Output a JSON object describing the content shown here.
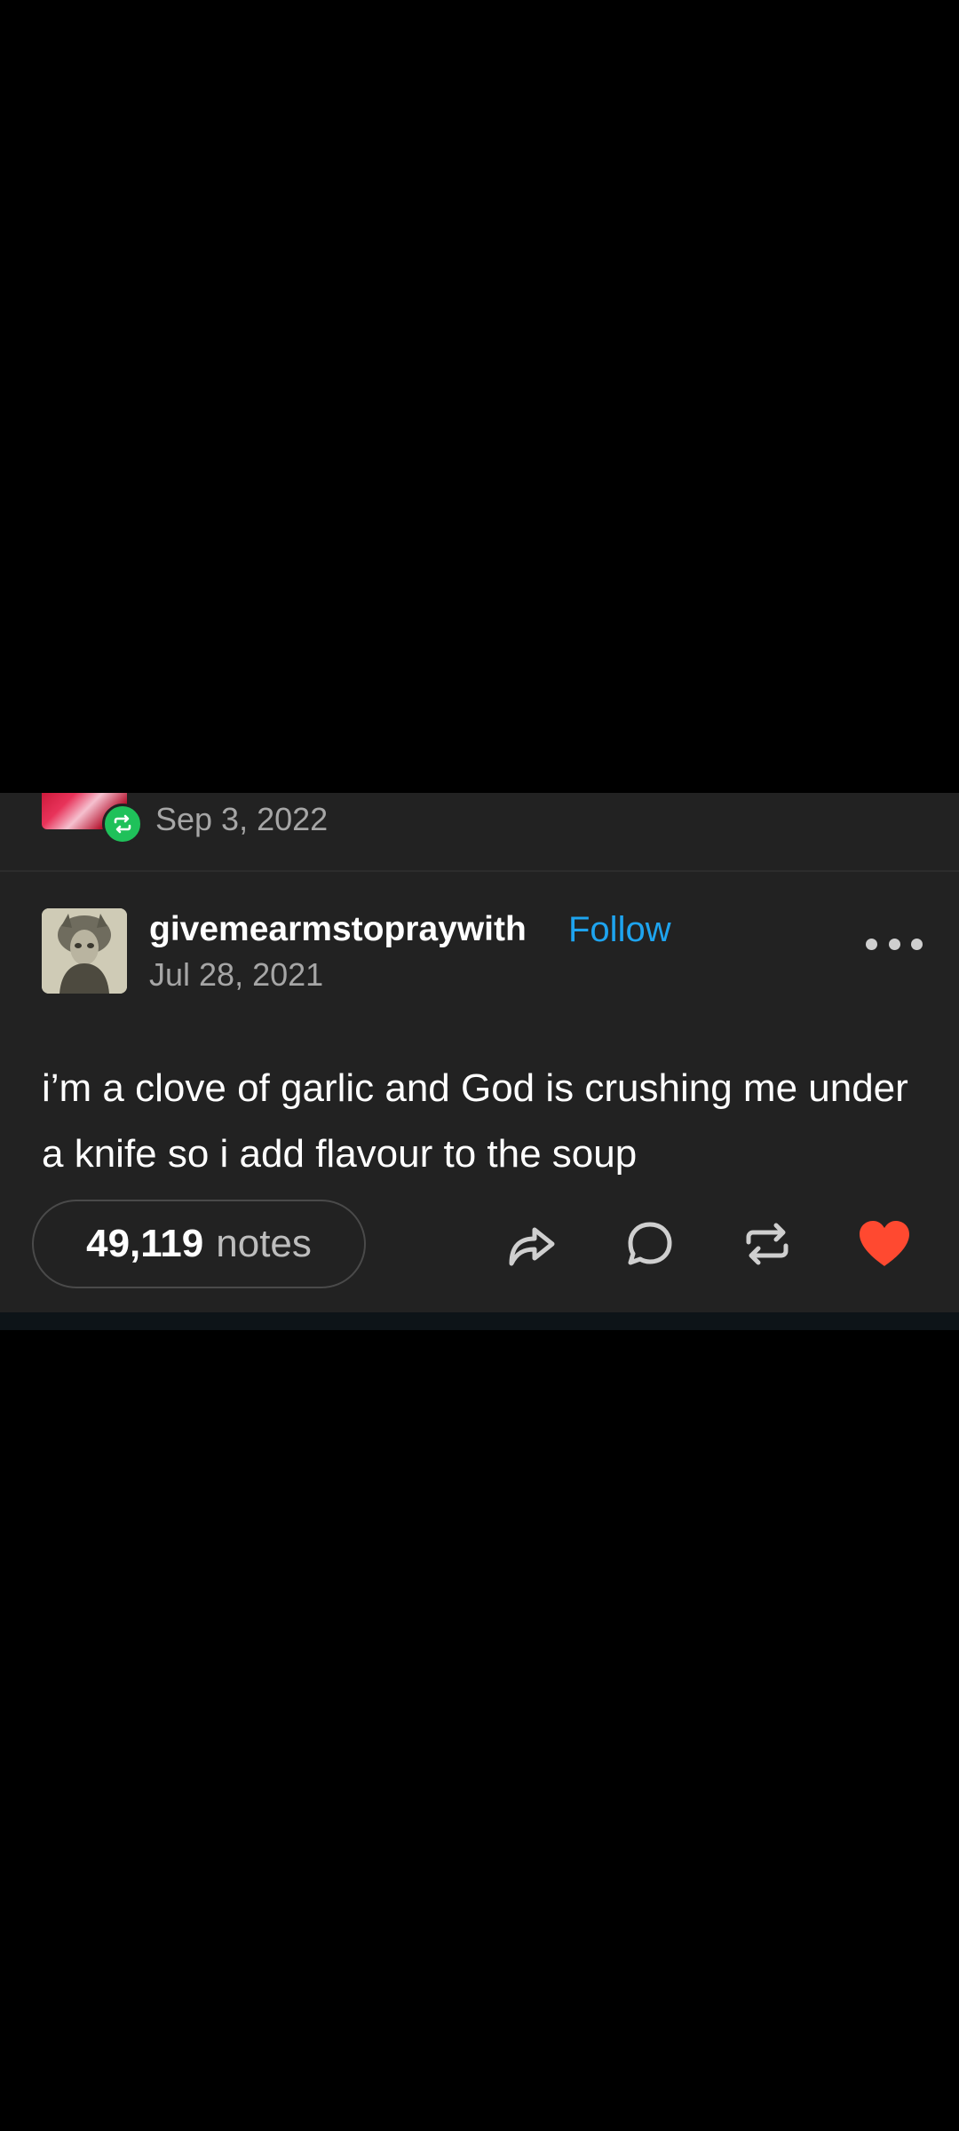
{
  "reblog": {
    "date": "Sep 3, 2022",
    "badge_icon": "reblog-icon",
    "badge_color": "#1fc15a"
  },
  "post": {
    "username": "givemearmstopraywith",
    "follow_label": "Follow",
    "date": "Jul 28, 2021",
    "body": "i’m a clove of garlic and God is crushing me under a knife so i add flavour to the soup",
    "more_icon": "more-horizontal-icon"
  },
  "footer": {
    "notes_count": "49,119",
    "notes_label": "notes",
    "actions": [
      "share-icon",
      "comment-icon",
      "reblog-icon",
      "heart-icon"
    ]
  },
  "colors": {
    "accent": "#1ea4ef",
    "like": "#ff4930",
    "card_bg": "#222222",
    "page_bg": "#000000"
  }
}
